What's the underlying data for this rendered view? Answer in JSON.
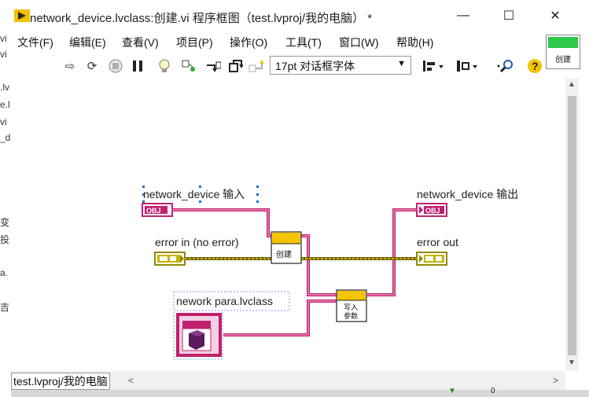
{
  "window": {
    "title": "network_device.lvclass:创建.vi 程序框图（test.lvproj/我的电脑） *",
    "minimize": "—",
    "maximize": "☐",
    "close": "✕"
  },
  "left_strip": [
    "vi",
    "vi",
    ".lv",
    "e.l",
    "vi",
    "_d",
    "变",
    "投",
    "a.",
    "吉"
  ],
  "menu": [
    "文件(F)",
    "编辑(E)",
    "查看(V)",
    "项目(P)",
    "操作(O)",
    "工具(T)",
    "窗口(W)",
    "帮助(H)"
  ],
  "toolbar": {
    "font_value": "17pt 对话框字体",
    "icons": [
      "run-arrow-icon",
      "run-continuously-icon",
      "abort-icon",
      "pause-icon",
      "highlight-bulb-icon",
      "retain-wire-icon",
      "step-into-icon",
      "step-over-icon",
      "step-out-icon",
      "align-icon",
      "distribute-icon",
      "search-icon",
      "help-icon"
    ]
  },
  "corner_icon_label": "创建",
  "diagram": {
    "label_nd_in": "network_device 输入",
    "label_nd_out": "network_device 输出",
    "label_err_in": "error in (no error)",
    "label_err_out": "error out",
    "label_nework": "nework para.lvclass",
    "obj_tag": "OBJ",
    "node_create": "创建",
    "node_write_1": "写入",
    "node_write_2": "参数",
    "wire_pink": "#c0206e",
    "wire_error": "#c8b400"
  },
  "bottom": {
    "project_label": "test.lvproj/我的电脑",
    "partial_text": "0"
  }
}
